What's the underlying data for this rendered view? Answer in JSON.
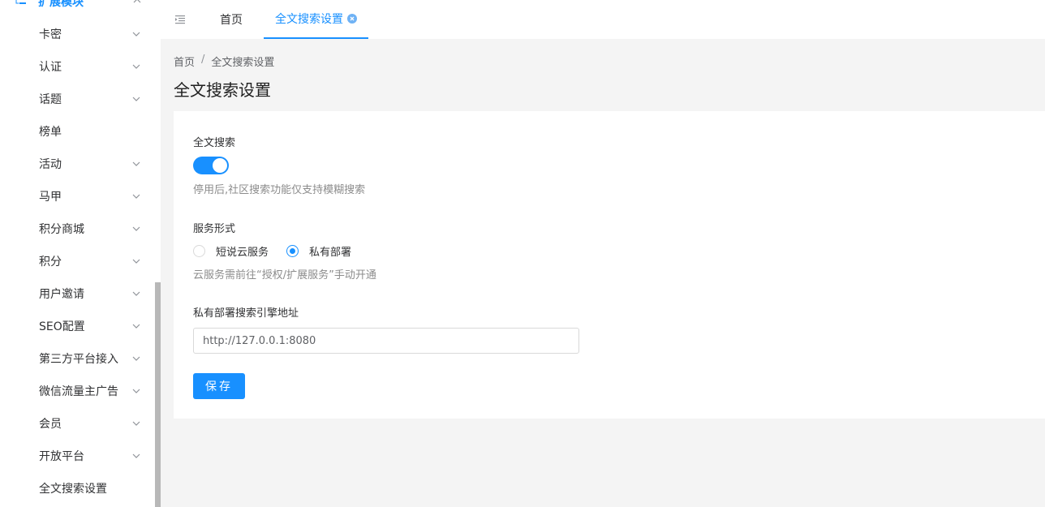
{
  "sidebar": {
    "group": {
      "label": "扩展模块",
      "icon": "tree-list-icon",
      "expanded": true
    },
    "items": [
      {
        "label": "卡密",
        "has_children": true
      },
      {
        "label": "认证",
        "has_children": true
      },
      {
        "label": "话题",
        "has_children": true
      },
      {
        "label": "榜单",
        "has_children": false
      },
      {
        "label": "活动",
        "has_children": true
      },
      {
        "label": "马甲",
        "has_children": true
      },
      {
        "label": "积分商城",
        "has_children": true
      },
      {
        "label": "积分",
        "has_children": true
      },
      {
        "label": "用户邀请",
        "has_children": true
      },
      {
        "label": "SEO配置",
        "has_children": true
      },
      {
        "label": "第三方平台接入",
        "has_children": true
      },
      {
        "label": "微信流量主广告",
        "has_children": true
      },
      {
        "label": "会员",
        "has_children": true
      },
      {
        "label": "开放平台",
        "has_children": true
      },
      {
        "label": "全文搜索设置",
        "has_children": false
      }
    ]
  },
  "tabs": {
    "home": "首页",
    "active": "全文搜索设置"
  },
  "breadcrumb": {
    "home": "首页",
    "sep": "/",
    "current": "全文搜索设置"
  },
  "page": {
    "title": "全文搜索设置"
  },
  "form": {
    "fulltext": {
      "label": "全文搜索",
      "enabled": true,
      "hint": "停用后,社区搜索功能仅支持模糊搜索"
    },
    "service": {
      "label": "服务形式",
      "options": [
        "短说云服务",
        "私有部署"
      ],
      "selected": "私有部署",
      "hint": "云服务需前往“授权/扩展服务”手动开通"
    },
    "engine": {
      "label": "私有部署搜索引擎地址",
      "value": "http://127.0.0.1:8080"
    },
    "save_label": "保存"
  },
  "colors": {
    "accent": "#1890ff"
  }
}
